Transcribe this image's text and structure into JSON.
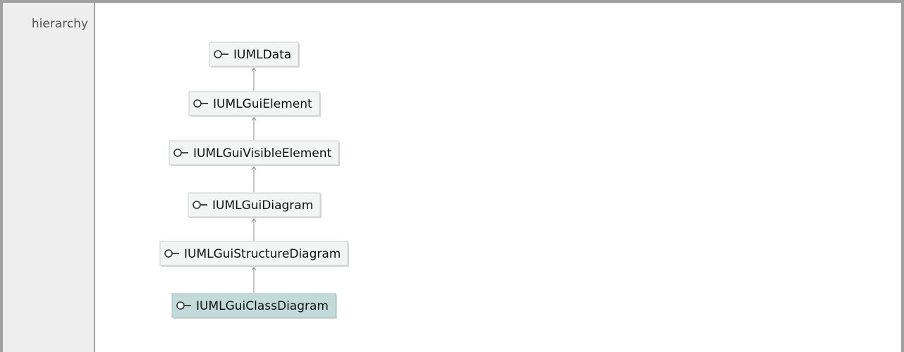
{
  "header": {
    "label": "hierarchy"
  },
  "colors": {
    "node_fill": "#f2f5f4",
    "node_border": "#c9d1cf",
    "selected_fill": "#c3dadb",
    "selected_border": "#a6c3c5",
    "connector": "#8a8a8a"
  },
  "hierarchy": {
    "nodes": [
      {
        "label": "IUMLData",
        "icon": "interface-icon",
        "selected": false
      },
      {
        "label": "IUMLGuiElement",
        "icon": "interface-icon",
        "selected": false
      },
      {
        "label": "IUMLGuiVisibleElement",
        "icon": "interface-icon",
        "selected": false
      },
      {
        "label": "IUMLGuiDiagram",
        "icon": "interface-icon",
        "selected": false
      },
      {
        "label": "IUMLGuiStructureDiagram",
        "icon": "interface-icon",
        "selected": false
      },
      {
        "label": "IUMLGuiClassDiagram",
        "icon": "interface-icon",
        "selected": true
      }
    ]
  }
}
